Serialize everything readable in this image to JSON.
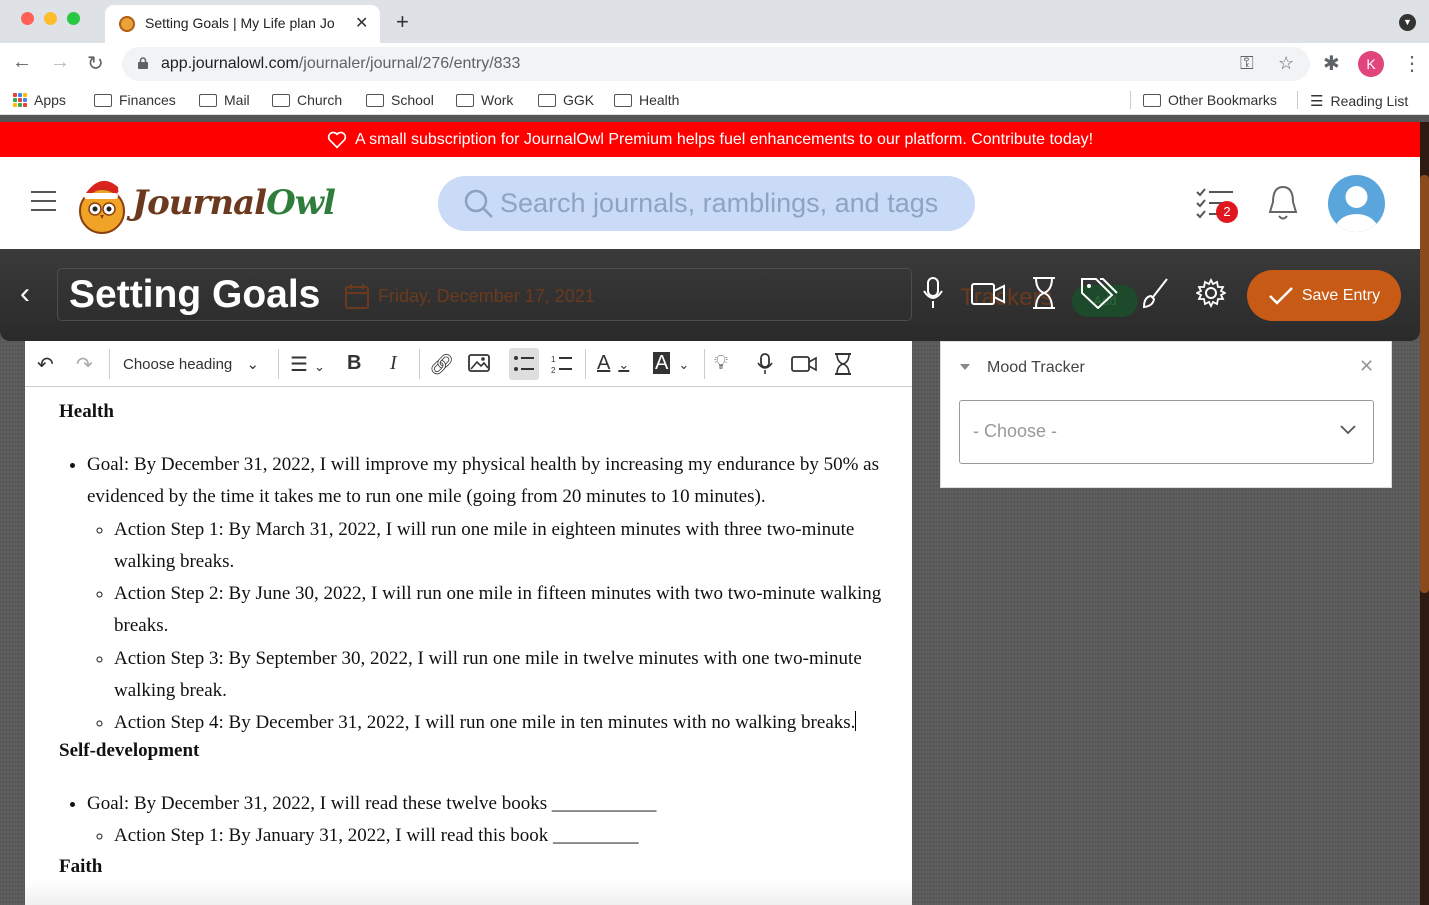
{
  "browser": {
    "tab_title": "Setting Goals | My Life plan Jou",
    "url_host": "app.journalowl.com",
    "url_path": "/journaler/journal/276/entry/833",
    "profile_initial": "K",
    "bookmarks": [
      "Apps",
      "Finances",
      "Mail",
      "Church",
      "School",
      "Work",
      "GGK",
      "Health"
    ],
    "bookmarks_right": [
      "Other Bookmarks",
      "Reading List"
    ]
  },
  "banner": {
    "text": "A small subscription for JournalOwl Premium helps fuel enhancements to our platform. Contribute today!"
  },
  "header": {
    "logo_part1": "Journal",
    "logo_part2": "Owl",
    "search_placeholder": "Search journals, ramblings, and tags",
    "notifications_count": "2"
  },
  "entry": {
    "title": "Setting Goals",
    "date": "Friday, December 17, 2021",
    "save_label": "Save Entry",
    "trackers_ghost": "Trackers",
    "add_ghost": "Add"
  },
  "editor": {
    "heading_select": "Choose heading",
    "section1": "Health",
    "s1_goal": "Goal: By December 31, 2022, I will improve my physical health by increasing my endurance by 50% as evidenced by the time it takes me to run one mile (going from 20 minutes to 10 minutes).",
    "s1_steps": [
      "Action Step 1: By March 31, 2022, I will run one mile in eighteen minutes with three two-minute walking breaks.",
      "Action Step 2: By June 30, 2022, I will run one mile in fifteen minutes with two two-minute walking breaks.",
      "Action Step 3: By September 30, 2022, I will run one mile in twelve minutes with one two-minute walking break.",
      "Action Step 4: By December 31, 2022, I will run one mile in ten minutes with no walking breaks."
    ],
    "section2": "Self-development",
    "s2_goal": "Goal: By December 31, 2022, I will read these twelve books ___________",
    "s2_step1": "Action Step 1: By January 31, 2022, I will read this book _________",
    "section3": "Faith"
  },
  "trackers": {
    "mood_label": "Mood Tracker",
    "select_value": "- Choose -"
  },
  "colors": {
    "banner": "#ff0000",
    "save": "#c75a15",
    "search_bg": "#c9dbf6",
    "logo_brown": "#6b3a1e",
    "logo_green": "#2e7d3a"
  }
}
